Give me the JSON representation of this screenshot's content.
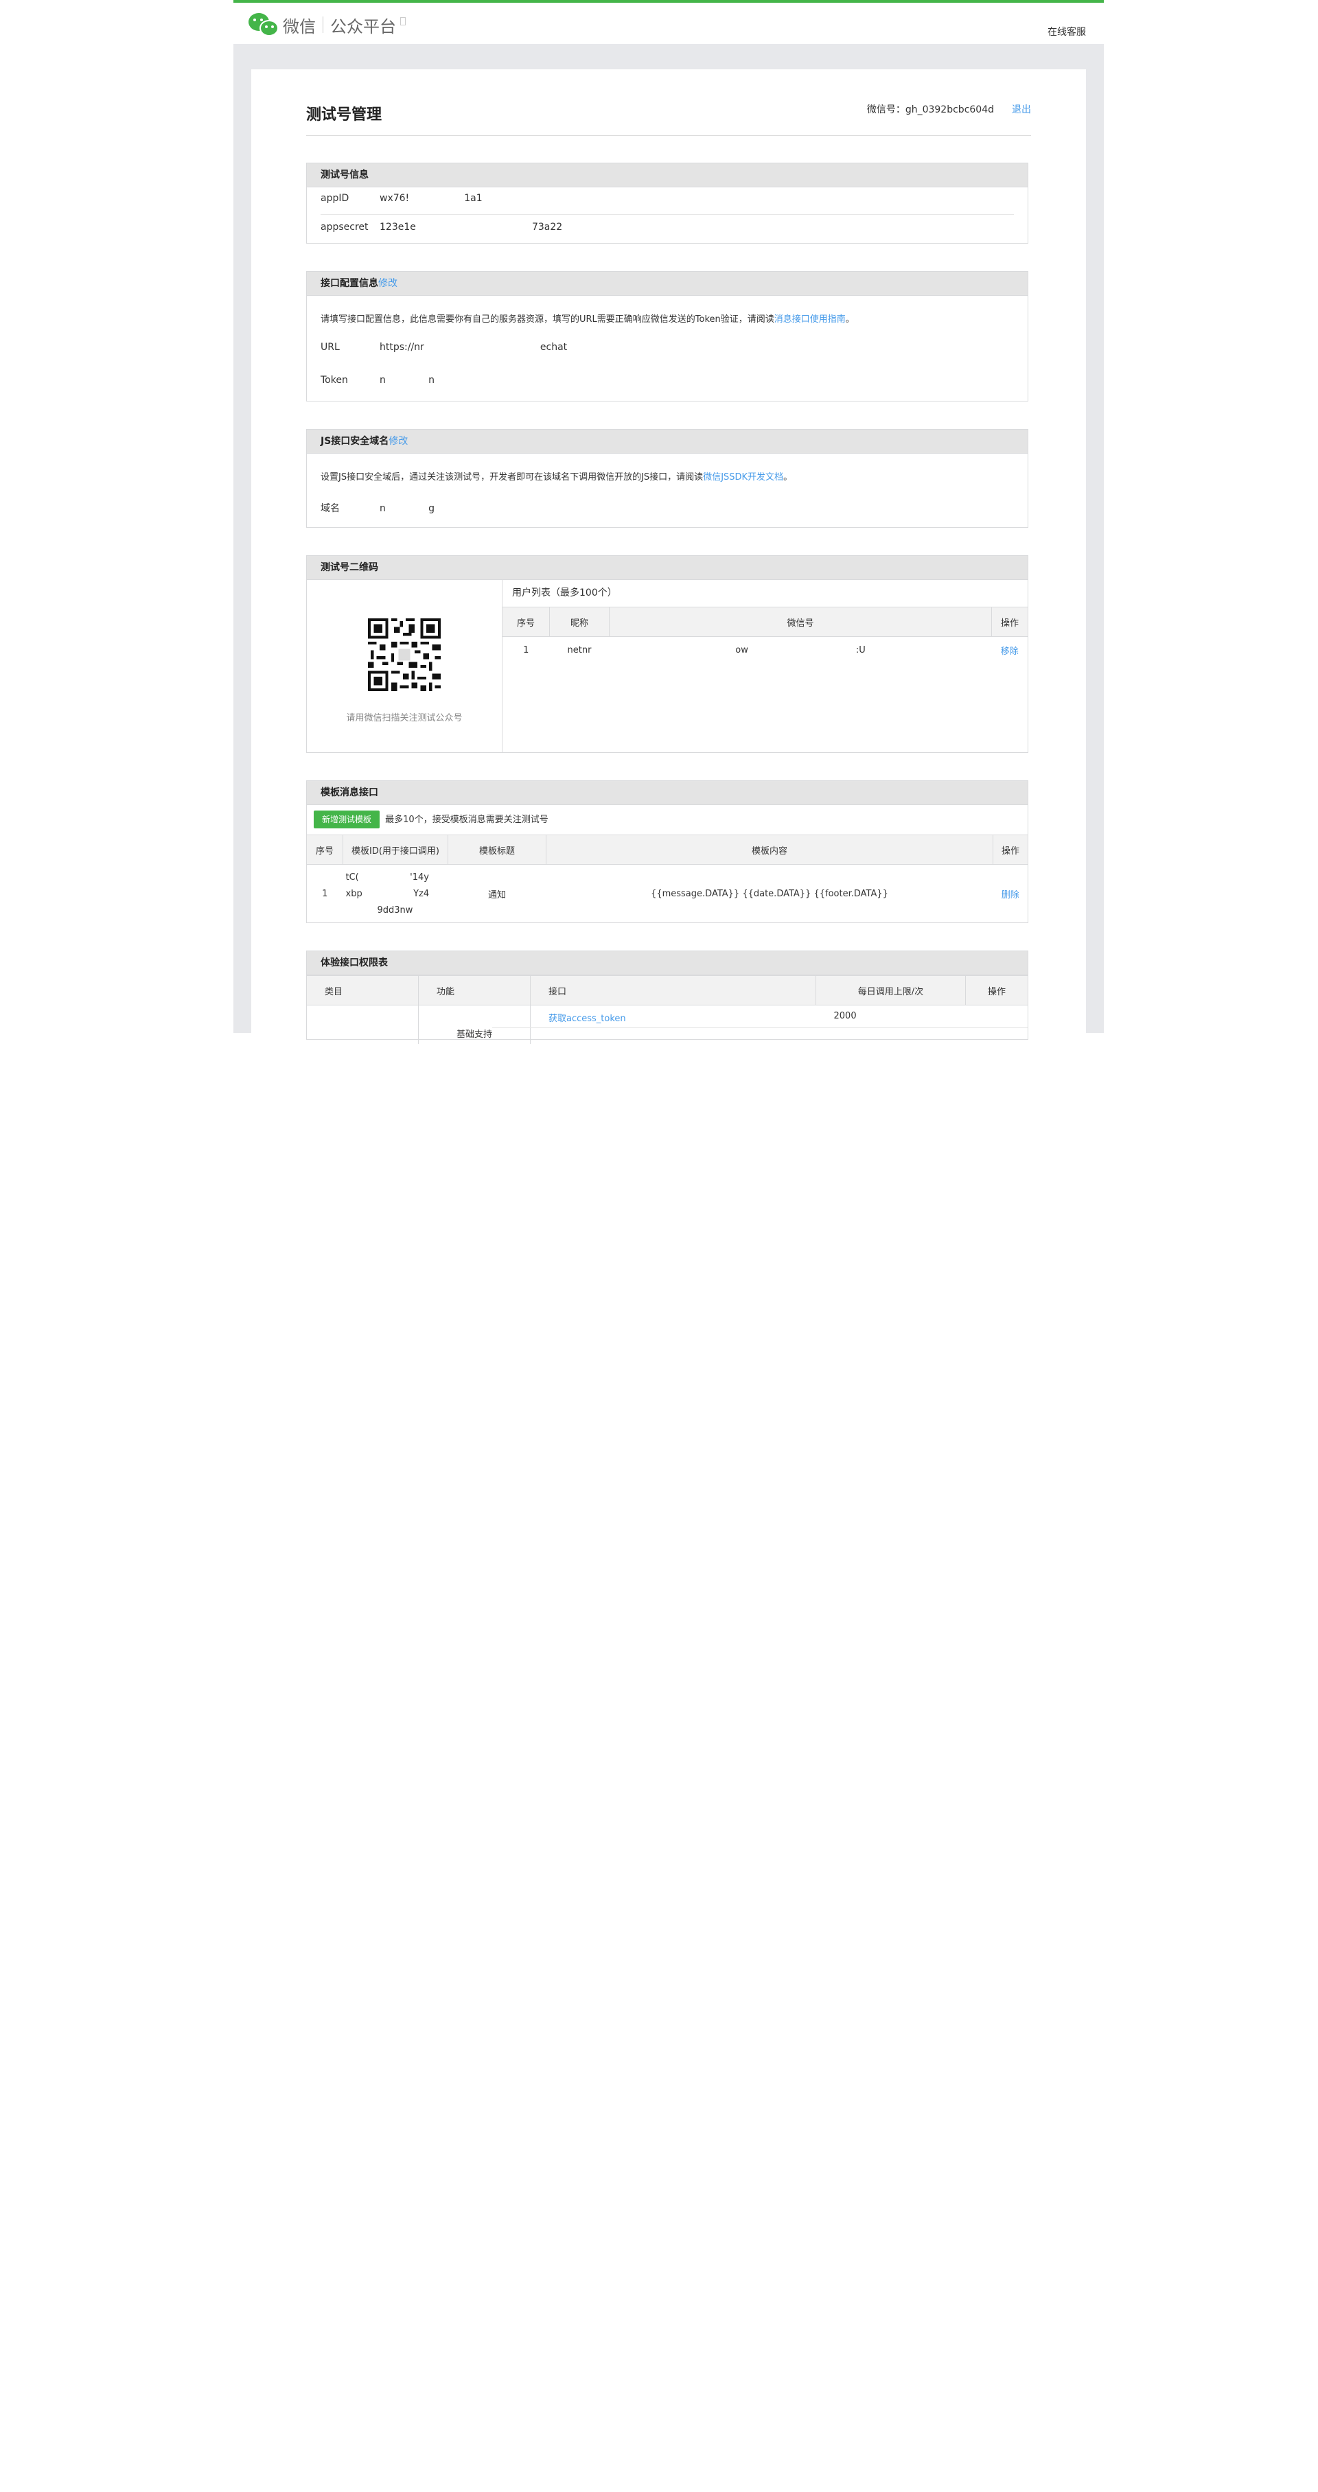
{
  "header": {
    "logo_wechat": "微信",
    "logo_platform": "公众平台",
    "top_right_link": "在线客服"
  },
  "page": {
    "title": "测试号管理",
    "account_label": "微信号：",
    "account_value": "gh_0392bcbc604d",
    "logout": "退出"
  },
  "test_info": {
    "title": "测试号信息",
    "appid_label": "appID",
    "appid_value": "wx76!                  1a1",
    "appsecret_label": "appsecret",
    "appsecret_value": "123e1e                                      73a22"
  },
  "api_config": {
    "title": "接口配置信息",
    "edit": "修改",
    "desc": "请填写接口配置信息，此信息需要你有自己的服务器资源，填写的URL需要正确响应微信发送的Token验证，请阅读",
    "desc_link": "消息接口使用指南",
    "desc_end": "。",
    "url_label": "URL",
    "url_value": "https://nr                                      echat",
    "token_label": "Token",
    "token_value": "n              n"
  },
  "js_domain": {
    "title": "JS接口安全域名",
    "edit": "修改",
    "desc": "设置JS接口安全域后，通过关注该测试号，开发者即可在该域名下调用微信开放的JS接口，请阅读",
    "desc_link": "微信JSSDK开发文档",
    "desc_end": "。",
    "domain_label": "域名",
    "domain_value": "n              g"
  },
  "qrcode": {
    "title": "测试号二维码",
    "caption": "请用微信扫描关注测试公众号",
    "user_list_title": "用户列表（最多100个）",
    "columns": [
      "序号",
      "昵称",
      "微信号",
      "操作"
    ],
    "rows": [
      {
        "index": "1",
        "nickname": "netnr",
        "wxid": "ow                                      :U",
        "action": "移除"
      }
    ]
  },
  "template": {
    "title": "模板消息接口",
    "add_button": "新增测试模板",
    "note": "最多10个，接受模板消息需要关注测试号",
    "columns": [
      "序号",
      "模板ID(用于接口调用)",
      "模板标题",
      "模板内容",
      "操作"
    ],
    "rows": [
      {
        "index": "1",
        "id_line1": "tC(                  '14y",
        "id_line2": "xbp                  Yz4",
        "id_line3": "9dd3nw",
        "title": "通知",
        "content": "{{message.DATA}} {{date.DATA}} {{footer.DATA}}",
        "action": "删除"
      }
    ]
  },
  "perm": {
    "title": "体验接口权限表",
    "columns": [
      "类目",
      "功能",
      "接口",
      "每日调用上限/次",
      "操作"
    ],
    "rows": [
      {
        "category": "",
        "feature": "基础支持",
        "api": "获取access_token",
        "limit": "2000",
        "action": ""
      }
    ]
  }
}
